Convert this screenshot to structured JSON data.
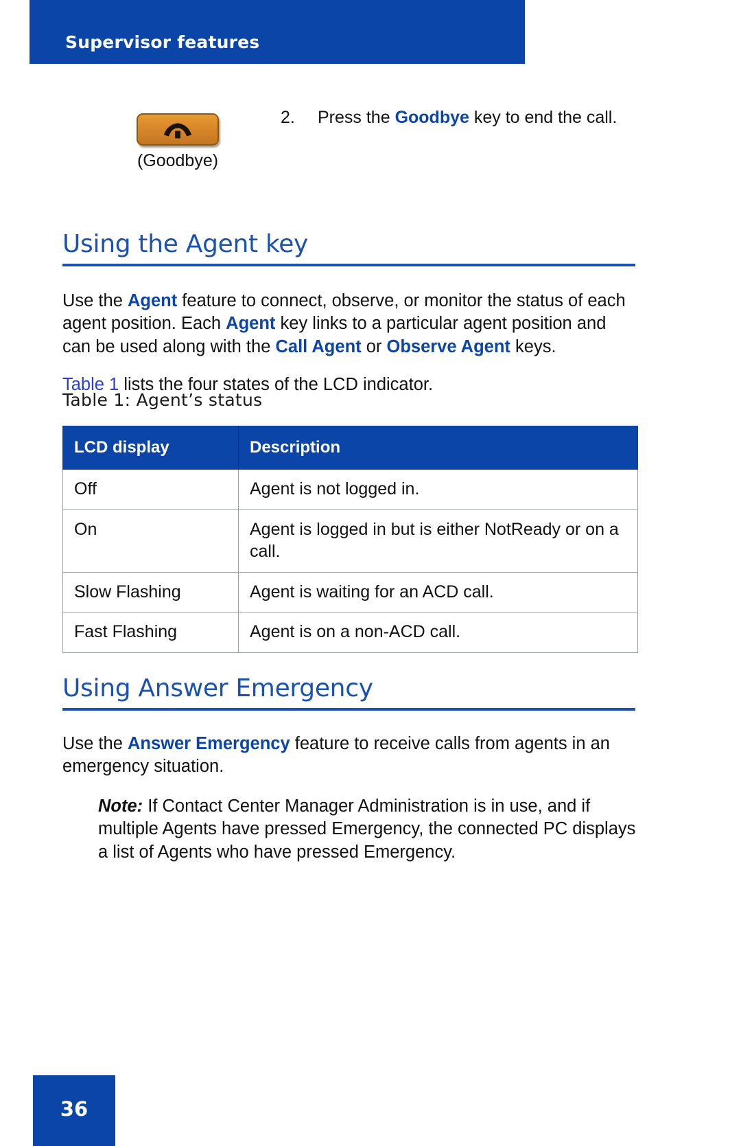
{
  "page": {
    "running_header": "Supervisor features",
    "page_number": "36",
    "header_color": "#0B45A8",
    "heading_color": "#1B52B0",
    "link_color": "#2A3FD6",
    "key_color": "#D9882A"
  },
  "step": {
    "number": "2.",
    "text_before": "Press the ",
    "emphasis": "Goodbye",
    "text_after": " key to end the call.",
    "key_caption": "(Goodbye)",
    "key_icon": "phone-hangup-icon"
  },
  "sections": [
    {
      "heading": "Using the Agent key",
      "paragraph": {
        "p1": "Use the ",
        "b1": "Agent",
        "p2": " feature to connect, observe, or monitor the status of each agent position. Each ",
        "b2": "Agent",
        "p3": " key links to a particular agent position and can be used along with the ",
        "b3": "Call Agent",
        "p4": " or ",
        "b4": "Observe Agent",
        "p5": " keys."
      },
      "table_ref": {
        "link": "Table 1",
        "rest": " lists the four states of the LCD indicator."
      },
      "table": {
        "caption": "Table 1: Agent’s status",
        "columns": [
          "LCD display",
          "Description"
        ],
        "rows": [
          [
            "Off",
            "Agent is not logged in."
          ],
          [
            "On",
            "Agent is logged in but is either NotReady or on a call."
          ],
          [
            "Slow Flashing",
            "Agent is waiting for an ACD call."
          ],
          [
            "Fast Flashing",
            "Agent is on a non-ACD call."
          ]
        ]
      }
    },
    {
      "heading": "Using Answer Emergency",
      "paragraph": {
        "p1": "Use the ",
        "b1": "Answer Emergency",
        "p2": " feature to receive calls from agents in an emergency situation."
      },
      "note": {
        "label": "Note:",
        "text": " If Contact Center Manager Administration is in use, and if multiple Agents have pressed Emergency, the connected PC displays a list of Agents who have pressed Emergency."
      }
    }
  ]
}
